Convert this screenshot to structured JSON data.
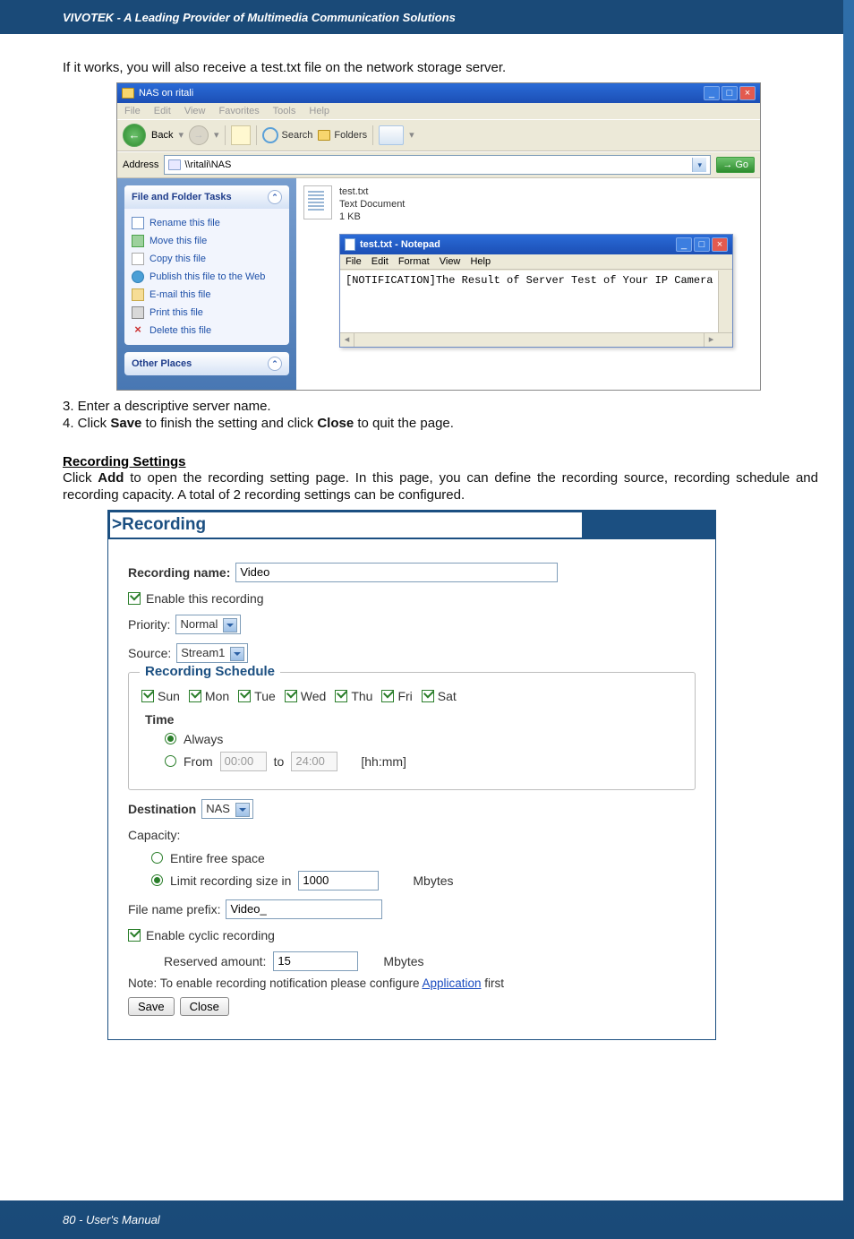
{
  "doc": {
    "header": "VIVOTEK - A Leading Provider of Multimedia Communication Solutions",
    "intro_line": "If it works, you will also receive a test.txt file on the network storage server.",
    "step3": "3. Enter a descriptive server name.",
    "step4_pre": "4. Click ",
    "step4_save": "Save",
    "step4_mid": " to finish the setting and click ",
    "step4_close": "Close",
    "step4_post": " to quit the page.",
    "rec_heading": "Recording Settings",
    "rec_para_pre": "Click ",
    "rec_para_add": "Add",
    "rec_para_post": " to open the recording setting page. In this page, you can define the recording source, recording schedule and recording capacity. A total of 2 recording settings can be configured.",
    "footer": "80 - User's Manual"
  },
  "explorer": {
    "title": "NAS on ritali",
    "menus": [
      "File",
      "Edit",
      "View",
      "Favorites",
      "Tools",
      "Help"
    ],
    "back": "Back",
    "search": "Search",
    "folders": "Folders",
    "addr_label": "Address",
    "addr_value": "\\\\ritali\\NAS",
    "go": "Go",
    "side_panel1": "File and Folder Tasks",
    "tasks": [
      {
        "icon": "ren",
        "label": "Rename this file"
      },
      {
        "icon": "mov",
        "label": "Move this file"
      },
      {
        "icon": "cop",
        "label": "Copy this file"
      },
      {
        "icon": "pub",
        "label": "Publish this file to the Web"
      },
      {
        "icon": "eml",
        "label": "E-mail this file"
      },
      {
        "icon": "prn",
        "label": "Print this file"
      },
      {
        "icon": "del",
        "label": "Delete this file"
      }
    ],
    "side_panel2": "Other Places",
    "file": {
      "name": "test.txt",
      "type": "Text Document",
      "size": "1 KB"
    },
    "notepad": {
      "title": "test.txt - Notepad",
      "menus": [
        "File",
        "Edit",
        "Format",
        "View",
        "Help"
      ],
      "content": "[NOTIFICATION]The Result of Server Test of Your IP Camera"
    }
  },
  "rec": {
    "banner": ">Recording",
    "name_label": "Recording name:",
    "name_value": "Video",
    "enable_label": "Enable this recording",
    "priority_label": "Priority:",
    "priority_value": "Normal",
    "source_label": "Source:",
    "source_value": "Stream1",
    "schedule_legend": "Recording Schedule",
    "days": [
      "Sun",
      "Mon",
      "Tue",
      "Wed",
      "Thu",
      "Fri",
      "Sat"
    ],
    "time_heading": "Time",
    "always": "Always",
    "from": "From",
    "from_val": "00:00",
    "to": "to",
    "to_val": "24:00",
    "hhmm": "[hh:mm]",
    "dest_label": "Destination",
    "dest_value": "NAS",
    "capacity_label": "Capacity:",
    "entire": "Entire free space",
    "limit_label": "Limit recording size in",
    "limit_value": "1000",
    "mbytes": "Mbytes",
    "prefix_label": "File name prefix:",
    "prefix_value": "Video_",
    "cyclic_label": "Enable cyclic recording",
    "reserved_label": "Reserved amount:",
    "reserved_value": "15",
    "note_pre": "Note: To enable recording notification please configure ",
    "note_link": "Application",
    "note_post": " first",
    "save_btn": "Save",
    "close_btn": "Close"
  }
}
